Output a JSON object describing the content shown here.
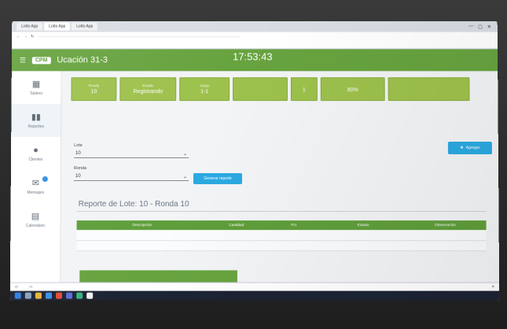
{
  "browser": {
    "tabs": [
      "Lotto App",
      "Lotto App",
      "Lotto App"
    ],
    "url": "",
    "bookmarks": []
  },
  "header": {
    "logo": "CPM",
    "title": "Ucación 31-3",
    "clock": "17:53:43",
    "clock_subtitle": "",
    "user": ""
  },
  "sidebar": {
    "items": [
      {
        "label": "Tablero",
        "icon": "dashboard-icon"
      },
      {
        "label": "Reportes",
        "icon": "chart-icon"
      },
      {
        "label": "Clientes",
        "icon": "user-icon"
      },
      {
        "label": "Mensajes",
        "icon": "mail-icon"
      },
      {
        "label": "Calendario",
        "icon": "calendar-icon"
      }
    ]
  },
  "cards": [
    {
      "label": "Ronda",
      "value": "10"
    },
    {
      "label": "Estado",
      "value": "Registrando"
    },
    {
      "label": "Juego",
      "value": "1-1"
    },
    {
      "label": "",
      "value": ""
    },
    {
      "label": "",
      "value": "1"
    },
    {
      "label": "",
      "value": "80%"
    },
    {
      "label": "",
      "value": ""
    }
  ],
  "form": {
    "lote_label": "Lote",
    "lote_value": "10",
    "ronda_label": "Ronda",
    "ronda_value": "10",
    "generate_label": "Generar reporte",
    "add_label": "Agregar"
  },
  "report": {
    "title": "Reporte de Lote: 10 - Ronda 10",
    "columns": [
      "Descripción",
      "Cantidad",
      "Pct",
      "Estado",
      "Observación"
    ],
    "rows": [
      [
        "",
        "",
        "",
        "",
        ""
      ],
      [
        "",
        "",
        "",
        "",
        ""
      ]
    ]
  },
  "summary": [
    {
      "line1": "",
      "line2": ""
    },
    {
      "line1": "",
      "line2": ""
    }
  ],
  "downloads": [],
  "taskbar": {
    "time": "",
    "date": ""
  },
  "colors": {
    "header": "#67a33f",
    "card": "#9dc14c",
    "accent": "#2ba9e1"
  }
}
